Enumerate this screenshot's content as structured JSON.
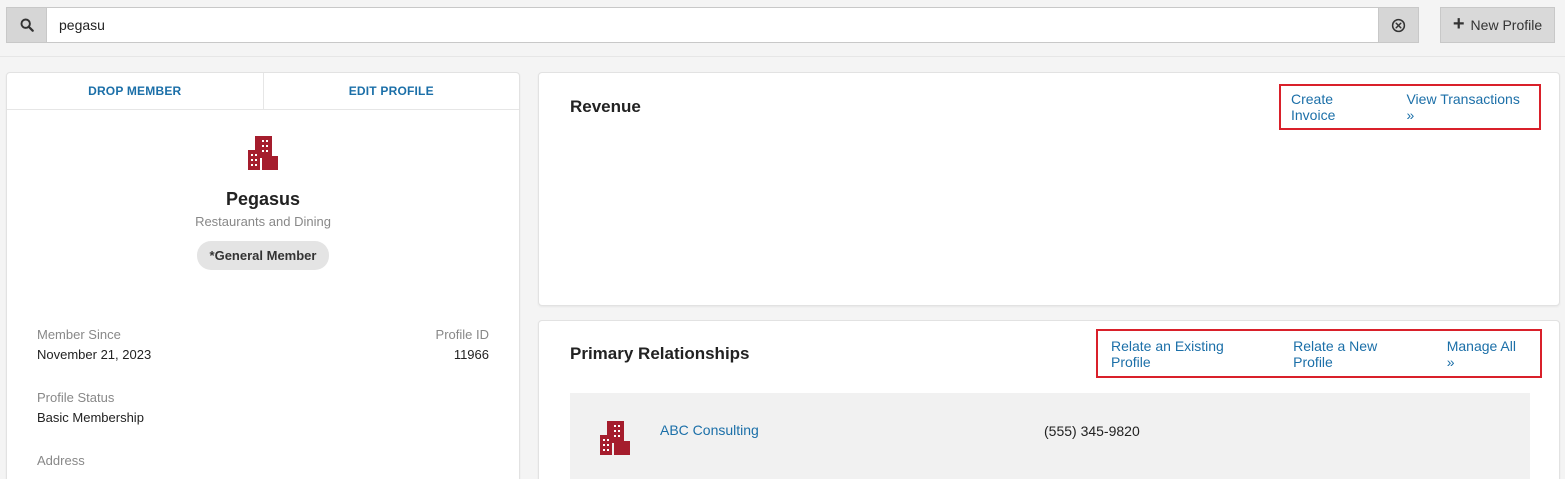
{
  "search": {
    "value": "pegasu",
    "icon": "search-icon",
    "clear_icon": "clear-circle-icon"
  },
  "header": {
    "new_profile_label": "New Profile"
  },
  "profile_card": {
    "tabs": [
      {
        "label": "DROP MEMBER"
      },
      {
        "label": "EDIT PROFILE"
      }
    ],
    "name": "Pegasus",
    "category": "Restaurants and Dining",
    "badge": "*General Member",
    "fields": {
      "member_since_label": "Member Since",
      "member_since_value": "November 21, 2023",
      "profile_id_label": "Profile ID",
      "profile_id_value": "11966",
      "status_label": "Profile Status",
      "status_value": "Basic Membership",
      "address_label": "Address"
    }
  },
  "revenue": {
    "title": "Revenue",
    "create_invoice": "Create Invoice",
    "view_transactions": "View Transactions »"
  },
  "relationships": {
    "title": "Primary Relationships",
    "relate_existing": "Relate an Existing Profile",
    "relate_new": "Relate a New Profile",
    "manage_all": "Manage All »",
    "items": [
      {
        "name": "ABC Consulting",
        "phone": "(555) 345-9820"
      }
    ]
  },
  "colors": {
    "accent_link": "#1b6fa8",
    "brand_icon": "#a51d2d",
    "highlight_box": "#d9202a"
  }
}
